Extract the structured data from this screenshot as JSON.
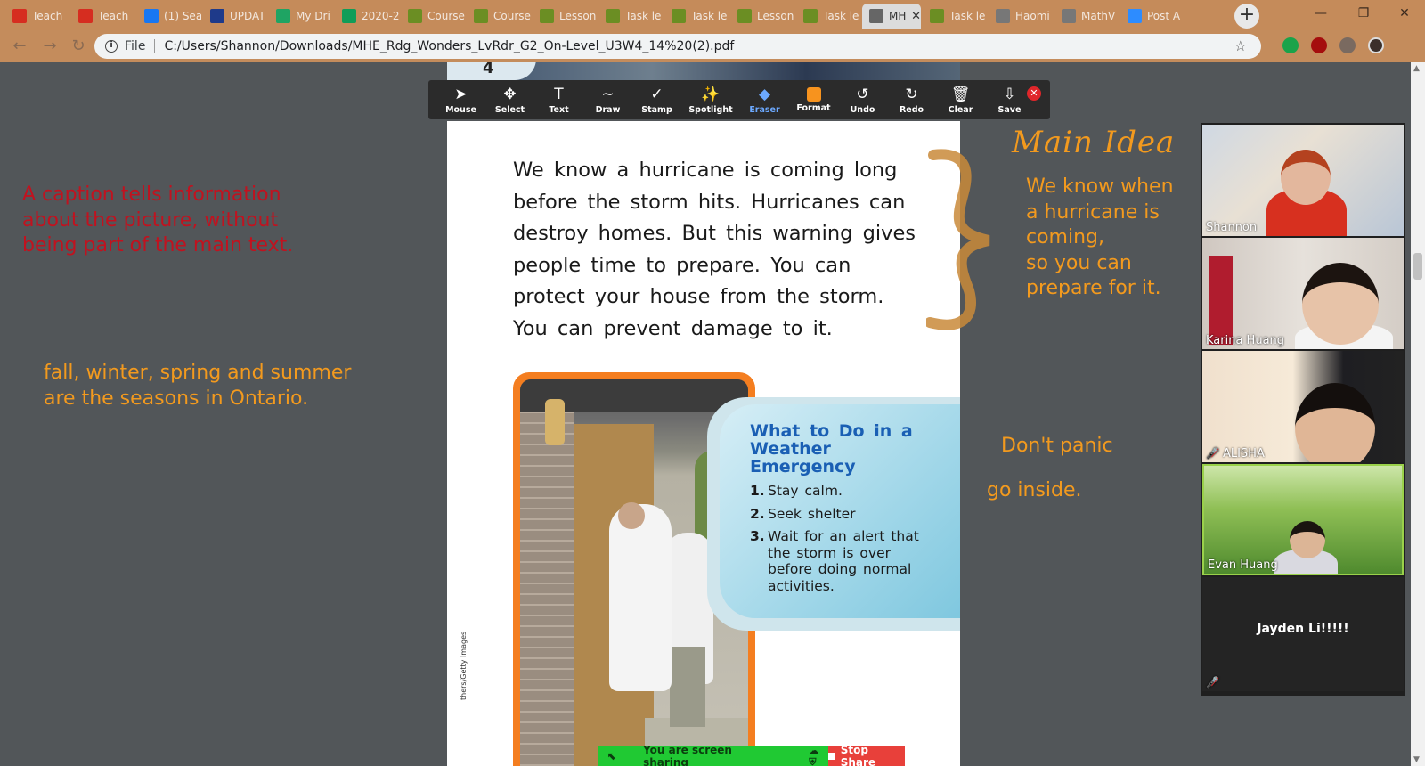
{
  "browser": {
    "tabs": [
      {
        "title": "Teach",
        "icon": "i-logo-icon",
        "color": "#d62d20"
      },
      {
        "title": "Teach",
        "icon": "i-logo-icon",
        "color": "#d62d20"
      },
      {
        "title": "(1) Sea",
        "icon": "facebook-icon",
        "color": "#1877f2"
      },
      {
        "title": "UPDAT",
        "icon": "tdsb-logo-icon",
        "color": "#1e3a8a"
      },
      {
        "title": "My Dri",
        "icon": "google-drive-icon",
        "color": "#1fa463"
      },
      {
        "title": "2020-2",
        "icon": "google-sheets-icon",
        "color": "#0f9d58"
      },
      {
        "title": "Course",
        "icon": "course-page-icon",
        "color": "#6b8e23"
      },
      {
        "title": "Course",
        "icon": "course-page-icon",
        "color": "#6b8e23"
      },
      {
        "title": "Lesson",
        "icon": "course-page-icon",
        "color": "#6b8e23"
      },
      {
        "title": "Task le",
        "icon": "course-page-icon",
        "color": "#6b8e23"
      },
      {
        "title": "Task le",
        "icon": "course-page-icon",
        "color": "#6b8e23"
      },
      {
        "title": "Lesson",
        "icon": "course-page-icon",
        "color": "#6b8e23"
      },
      {
        "title": "Task le",
        "icon": "course-page-icon",
        "color": "#6b8e23"
      },
      {
        "title": "MH",
        "icon": "globe-icon",
        "color": "#666666",
        "active": true
      },
      {
        "title": "Task le",
        "icon": "course-page-icon",
        "color": "#6b8e23"
      },
      {
        "title": "Haomi",
        "icon": "globe-icon",
        "color": "#777777"
      },
      {
        "title": "MathV",
        "icon": "globe-icon",
        "color": "#777777"
      },
      {
        "title": "Post A",
        "icon": "zoom-icon",
        "color": "#2d8cff"
      }
    ],
    "new_tab": "+",
    "window_controls": {
      "minimize": "—",
      "maximize": "❐",
      "close": "✕"
    },
    "address": {
      "scheme_label": "File",
      "url": "C:/Users/Shannon/Downloads/MHE_Rdg_Wonders_LvRdr_G2_On-Level_U3W4_14%20(2).pdf"
    }
  },
  "pdf": {
    "previous_page_number": "4",
    "paragraph_lines": [
      "We know a hurricane is coming long",
      "before the storm hits. Hurricanes can",
      "destroy homes. But this warning gives",
      "people time to prepare. You can",
      "protect your house from the storm.",
      "You can prevent damage to it."
    ],
    "photo_credit": "thers/Getty Images",
    "info_box": {
      "title": "What to Do in a Weather Emergency",
      "items": [
        {
          "num": "1.",
          "text": "Stay calm."
        },
        {
          "num": "2.",
          "text": "Seek shelter"
        },
        {
          "num": "3.",
          "text": "Wait for an alert that the storm is over before doing normal activities."
        }
      ]
    }
  },
  "annotate_toolbar": {
    "tools": [
      {
        "id": "mouse",
        "label": "Mouse",
        "icon": "cursor-arrow-icon",
        "glyph": "➤"
      },
      {
        "id": "select",
        "label": "Select",
        "icon": "move-arrows-icon",
        "glyph": "✥"
      },
      {
        "id": "text",
        "label": "Text",
        "icon": "text-t-icon",
        "glyph": "T"
      },
      {
        "id": "draw",
        "label": "Draw",
        "icon": "squiggle-icon",
        "glyph": "∼"
      },
      {
        "id": "stamp",
        "label": "Stamp",
        "icon": "checkmark-icon",
        "glyph": "✓"
      },
      {
        "id": "spotlight",
        "label": "Spotlight",
        "icon": "magic-wand-icon",
        "glyph": "✨"
      },
      {
        "id": "eraser",
        "label": "Eraser",
        "icon": "eraser-icon",
        "glyph": "◆",
        "active": true
      },
      {
        "id": "format",
        "label": "Format",
        "icon": "color-swatch-icon",
        "swatch": "#f7931e"
      },
      {
        "id": "undo",
        "label": "Undo",
        "icon": "undo-icon",
        "glyph": "↺"
      },
      {
        "id": "redo",
        "label": "Redo",
        "icon": "redo-icon",
        "glyph": "↻"
      },
      {
        "id": "clear",
        "label": "Clear",
        "icon": "trash-icon",
        "glyph": "🗑"
      },
      {
        "id": "save",
        "label": "Save",
        "icon": "download-icon",
        "glyph": "⇩"
      }
    ],
    "close_glyph": "✕"
  },
  "annotations": {
    "caption_note": [
      "A caption tells information",
      "about the picture, without",
      "being part of the main text."
    ],
    "seasons_note": [
      "fall, winter, spring and summer",
      "are the seasons in Ontario."
    ],
    "main_idea_title": "Main Idea",
    "main_idea_text": [
      "We know when",
      "a hurricane is",
      "coming,",
      "so you can",
      "prepare for it."
    ],
    "panic_note": "Don't panic",
    "inside_note": "go inside.",
    "colors": {
      "red": "#c1121f",
      "orange": "#f39a1e"
    }
  },
  "gallery": {
    "participants": [
      {
        "name": "Shannon",
        "muted": false
      },
      {
        "name": "Karina Huang",
        "muted": false
      },
      {
        "name": "ALISHA",
        "muted": true
      },
      {
        "name": "Evan Huang",
        "muted": false
      },
      {
        "name": "Jayden Li!!!!!",
        "muted": true,
        "video_off": true
      }
    ]
  },
  "share_bar": {
    "status": "You are screen sharing",
    "stop_label": "Stop Share"
  }
}
